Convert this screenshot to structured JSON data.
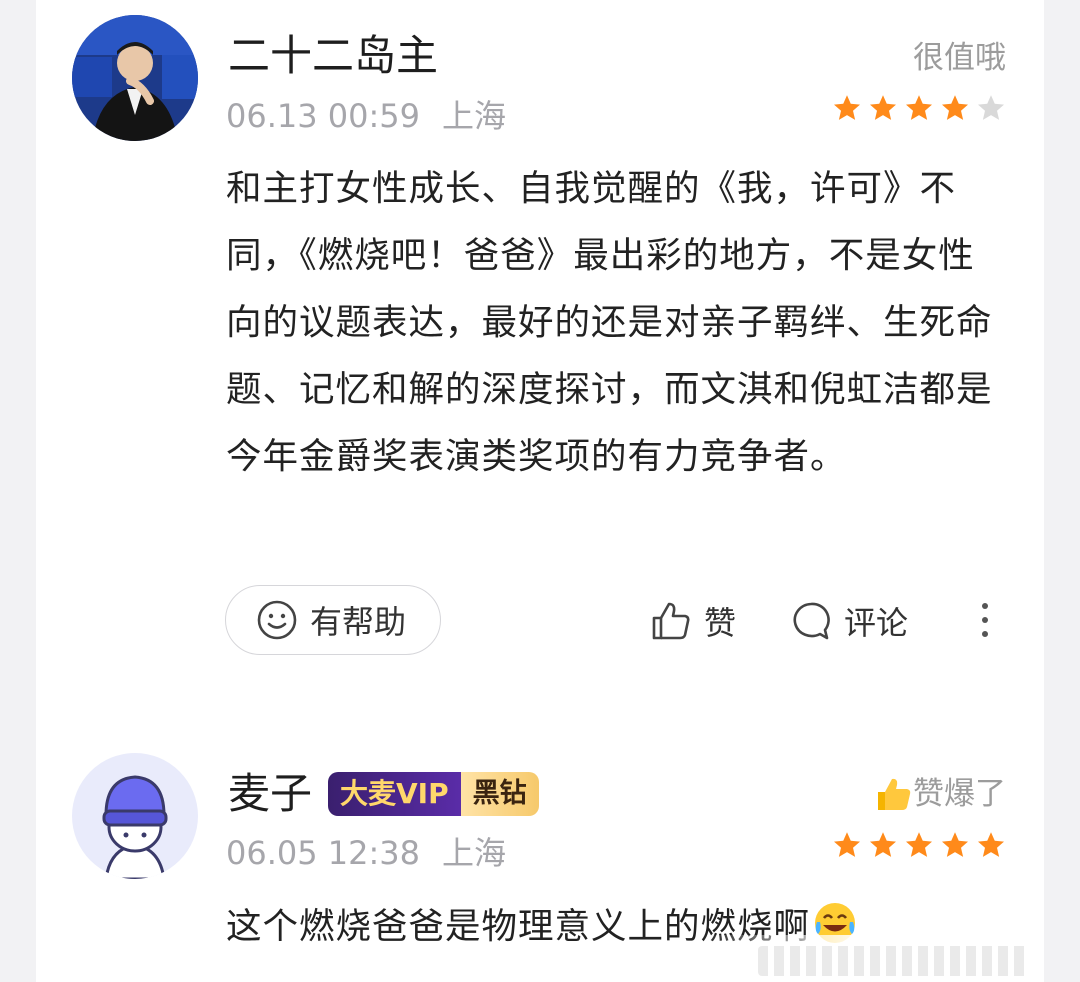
{
  "colors": {
    "star_on": "#ff8a1a",
    "star_off": "#d9d9d9",
    "accent_vip": "#5a2ca8"
  },
  "review1": {
    "user": "二十二岛主",
    "date": "06.13 00:59",
    "location": "上海",
    "rating_text": "很值哦",
    "rating": 4,
    "max_rating": 5,
    "text": "和主打女性成长、自我觉醒的《我，许可》不同，《燃烧吧！爸爸》最出彩的地方，不是女性向的议题表达，最好的还是对亲子羁绊、生死命题、记忆和解的深度探讨，而文淇和倪虹洁都是今年金爵奖表演类奖项的有力竞争者。",
    "helpful_label": "有帮助",
    "like_label": "赞",
    "comment_label": "评论"
  },
  "review2": {
    "user": "麦子",
    "badge_vip": "大麦VIP",
    "badge_tier": "黑钻",
    "date": "06.05 12:38",
    "location": "上海",
    "rating_text": "赞爆了",
    "rating": 5,
    "max_rating": 5,
    "text": "这个燃烧爸爸是物理意义上的燃烧啊"
  }
}
